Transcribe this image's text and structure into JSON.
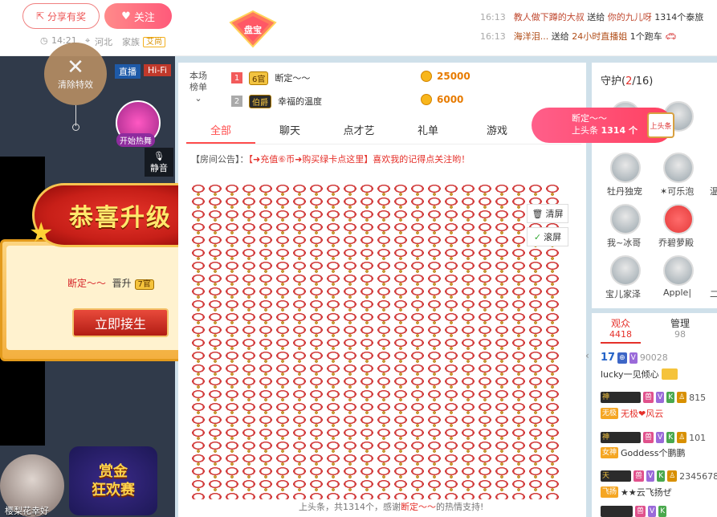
{
  "top": {
    "share_label": "分享有奖",
    "follow_label": "关注",
    "time": "14:21",
    "location": "河北",
    "family_label": "家族",
    "family_tag": "艾尚",
    "panbao_label": "盘宝",
    "messages": [
      {
        "time": "16:13",
        "text_a": "教人做下蹲的大叔",
        "mid": "送给",
        "text_b": "你的九儿呀",
        "tail": "1314个泰旅"
      },
      {
        "time": "16:13",
        "text_a": "海洋泪...",
        "mid": "送给",
        "text_b": "24小时直播姐",
        "tail": "1个跑车"
      }
    ]
  },
  "video": {
    "clear_label": "清除特效",
    "tag_live": "直播",
    "tag_hifi": "Hi-Fi",
    "dance_label": "开始热舞",
    "mute_label": "静音",
    "popup_title": "恭喜升级",
    "popup_name": "断定～～",
    "popup_mid": "晋升",
    "popup_level": "7官",
    "popup_button": "立即接生",
    "bottom_user": "樱梨花幸好",
    "bounty_line1": "赏金",
    "bounty_line2": "狂欢赛"
  },
  "rank": {
    "header_line1": "本场",
    "header_line2": "榜单",
    "rows": [
      {
        "num": "1",
        "level": "6官",
        "name": "断定～～",
        "coins": "25000"
      },
      {
        "num": "2",
        "level": "伯爵",
        "name": "幸福的温度",
        "coins": "6000"
      }
    ]
  },
  "chat": {
    "tabs": [
      "全部",
      "聊天",
      "点才艺",
      "礼单",
      "游戏"
    ],
    "notice_label": "【房间公告】：",
    "notice_text": "【➜充值⑥币➜购买绿卡点这里】喜欢我的记得点关注哟！",
    "clear_screen": "清屏",
    "scroll_screen": "滚屏",
    "footer_prefix": "上头条，共1314个，感谢",
    "footer_name": "断定～～",
    "footer_suffix": "的热情支持!"
  },
  "guard": {
    "title": "守护",
    "count": "2",
    "total": "/16)",
    "open": "(",
    "members": [
      "",
      "",
      "",
      "牡丹独宠",
      "✶可乐泡",
      "温",
      "我~冰哥",
      "乔碧萝殿",
      "",
      "宝儿家泽",
      "Apple|",
      "二"
    ]
  },
  "toast": {
    "name": "断定～～",
    "label": "上头条",
    "count": "1314 个",
    "ticket": "上头条"
  },
  "audience": {
    "tab_aud": "观众",
    "tab_aud_count": "4418",
    "tab_mgr": "管理",
    "tab_mgr_count": "98",
    "rows": [
      {
        "level": "17",
        "id": "90028",
        "name": "lucky一见倾心"
      },
      {
        "badge": "神",
        "num": "815",
        "tag": "无极",
        "name": "无极❤风云"
      },
      {
        "badge": "神",
        "num": "101",
        "tag": "女神",
        "name": "Goddess个鹏鹏"
      },
      {
        "badge": "天",
        "num": "2345678",
        "tag": "飞扬",
        "name": "★★云飞扬ぜ"
      }
    ]
  },
  "colors": {
    "accent": "#ff4d4d",
    "gold": "#f2c340",
    "brand_blue": "#cfe0ea"
  }
}
